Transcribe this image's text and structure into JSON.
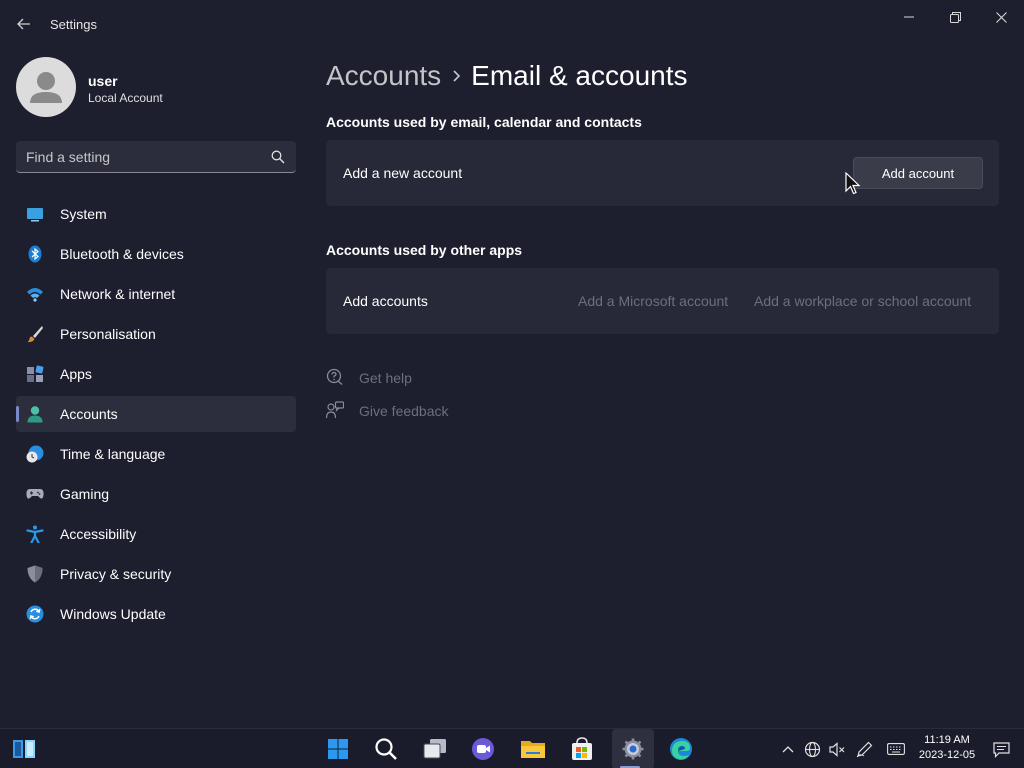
{
  "window": {
    "title": "Settings"
  },
  "profile": {
    "name": "user",
    "account_type": "Local Account"
  },
  "search": {
    "placeholder": "Find a setting",
    "value": ""
  },
  "sidebar": {
    "items": [
      {
        "label": "System",
        "icon": "monitor-icon",
        "active": false
      },
      {
        "label": "Bluetooth & devices",
        "icon": "bluetooth-icon",
        "active": false
      },
      {
        "label": "Network & internet",
        "icon": "wifi-icon",
        "active": false
      },
      {
        "label": "Personalisation",
        "icon": "brush-icon",
        "active": false
      },
      {
        "label": "Apps",
        "icon": "apps-icon",
        "active": false
      },
      {
        "label": "Accounts",
        "icon": "person-icon",
        "active": true
      },
      {
        "label": "Time & language",
        "icon": "globe-clock-icon",
        "active": false
      },
      {
        "label": "Gaming",
        "icon": "gamepad-icon",
        "active": false
      },
      {
        "label": "Accessibility",
        "icon": "accessibility-icon",
        "active": false
      },
      {
        "label": "Privacy & security",
        "icon": "shield-icon",
        "active": false
      },
      {
        "label": "Windows Update",
        "icon": "update-icon",
        "active": false
      }
    ]
  },
  "main": {
    "breadcrumb_parent": "Accounts",
    "breadcrumb_current": "Email & accounts",
    "section1": {
      "title": "Accounts used by email, calendar and contacts",
      "row_label": "Add a new account",
      "button_label": "Add account"
    },
    "section2": {
      "title": "Accounts used by other apps",
      "row_label": "Add accounts",
      "link_microsoft": "Add a Microsoft account",
      "link_workplace": "Add a workplace or school account"
    },
    "help": {
      "get_help": "Get help",
      "give_feedback": "Give feedback"
    }
  },
  "taskbar": {
    "apps": [
      "widgets-icon",
      "start-icon",
      "search-icon",
      "task-view-icon",
      "chat-icon",
      "file-explorer-icon",
      "store-icon",
      "settings-icon",
      "edge-icon"
    ],
    "active_app": "settings-icon",
    "clock_time": "11:19 AM",
    "clock_date": "2023-12-05"
  },
  "colors": {
    "accent": "#7a8ac8",
    "background": "#1d1e2e",
    "card": "#272838",
    "dim_text": "#6e6f7c"
  }
}
